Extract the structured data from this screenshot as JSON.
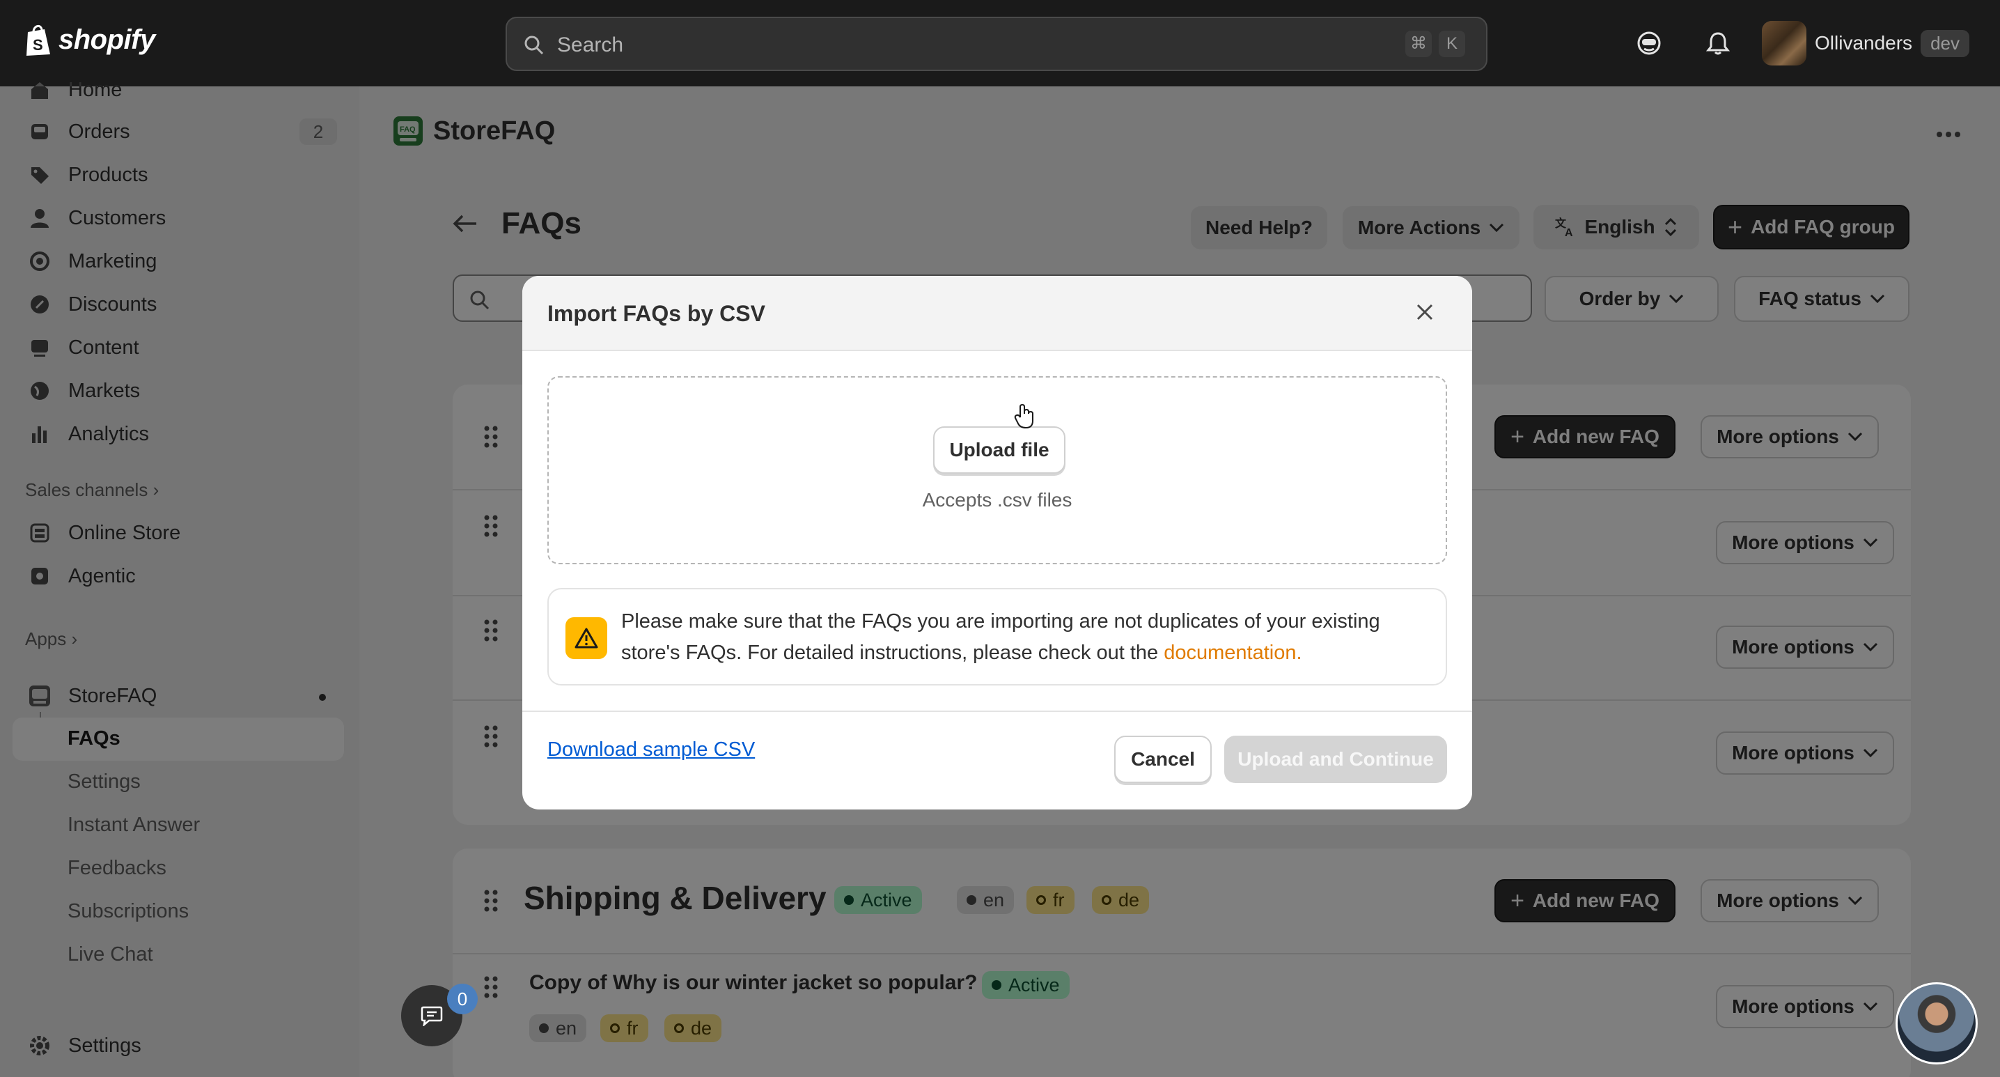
{
  "topbar": {
    "brand": "shopify",
    "search_placeholder": "Search",
    "shortcut_keys": [
      "⌘",
      "K"
    ],
    "store_name": "Ollivanders",
    "store_tag": "dev"
  },
  "sidebar": {
    "items": [
      {
        "label": "Home",
        "icon": "home-icon"
      },
      {
        "label": "Orders",
        "icon": "inbox-icon",
        "badge": "2"
      },
      {
        "label": "Products",
        "icon": "tag-icon"
      },
      {
        "label": "Customers",
        "icon": "person-icon"
      },
      {
        "label": "Marketing",
        "icon": "target-icon"
      },
      {
        "label": "Discounts",
        "icon": "discount-icon"
      },
      {
        "label": "Content",
        "icon": "content-icon"
      },
      {
        "label": "Markets",
        "icon": "globe-icon"
      },
      {
        "label": "Analytics",
        "icon": "bar-chart-icon"
      }
    ],
    "sales_channels_label": "Sales channels",
    "sales_channels": [
      {
        "label": "Online Store",
        "icon": "store-icon"
      },
      {
        "label": "Agentic",
        "icon": "agentic-icon"
      }
    ],
    "apps_label": "Apps",
    "app": {
      "label": "StoreFAQ",
      "subitems": [
        "FAQs",
        "Settings",
        "Instant Answer",
        "Feedbacks",
        "Subscriptions",
        "Live Chat"
      ],
      "active": "FAQs"
    },
    "settings_label": "Settings"
  },
  "main": {
    "app_name": "StoreFAQ",
    "page_title": "FAQs",
    "buttons": {
      "need_help": "Need Help?",
      "more_actions": "More Actions",
      "language": "English",
      "add_group": "Add FAQ group",
      "order_by": "Order by",
      "faq_status": "FAQ status",
      "add_new_faq": "Add new FAQ",
      "more_options": "More options"
    },
    "group": {
      "title": "Shipping & Delivery",
      "status": "Active",
      "langs": [
        "en",
        "fr",
        "de"
      ]
    },
    "faq": {
      "question": "Copy of Why is our winter jacket so popular?",
      "status": "Active",
      "langs": [
        "en",
        "fr",
        "de"
      ]
    }
  },
  "modal": {
    "title": "Import FAQs by CSV",
    "upload_label": "Upload file",
    "accepts": "Accepts .csv files",
    "warning_text": "Please make sure that the FAQs you are importing are not duplicates of your existing store's FAQs. For detailed instructions, please check out the ",
    "warning_link": "documentation.",
    "download_link": "Download sample CSV",
    "cancel_label": "Cancel",
    "continue_label": "Upload and Continue"
  },
  "chat": {
    "count": "0"
  },
  "colors": {
    "topbar": "#1a1a1a",
    "primary_dark": "#303030",
    "active_badge": "#b4fed2",
    "partial_badge": "#ffe68c",
    "warning": "#ffb800",
    "link": "#005bd3"
  }
}
